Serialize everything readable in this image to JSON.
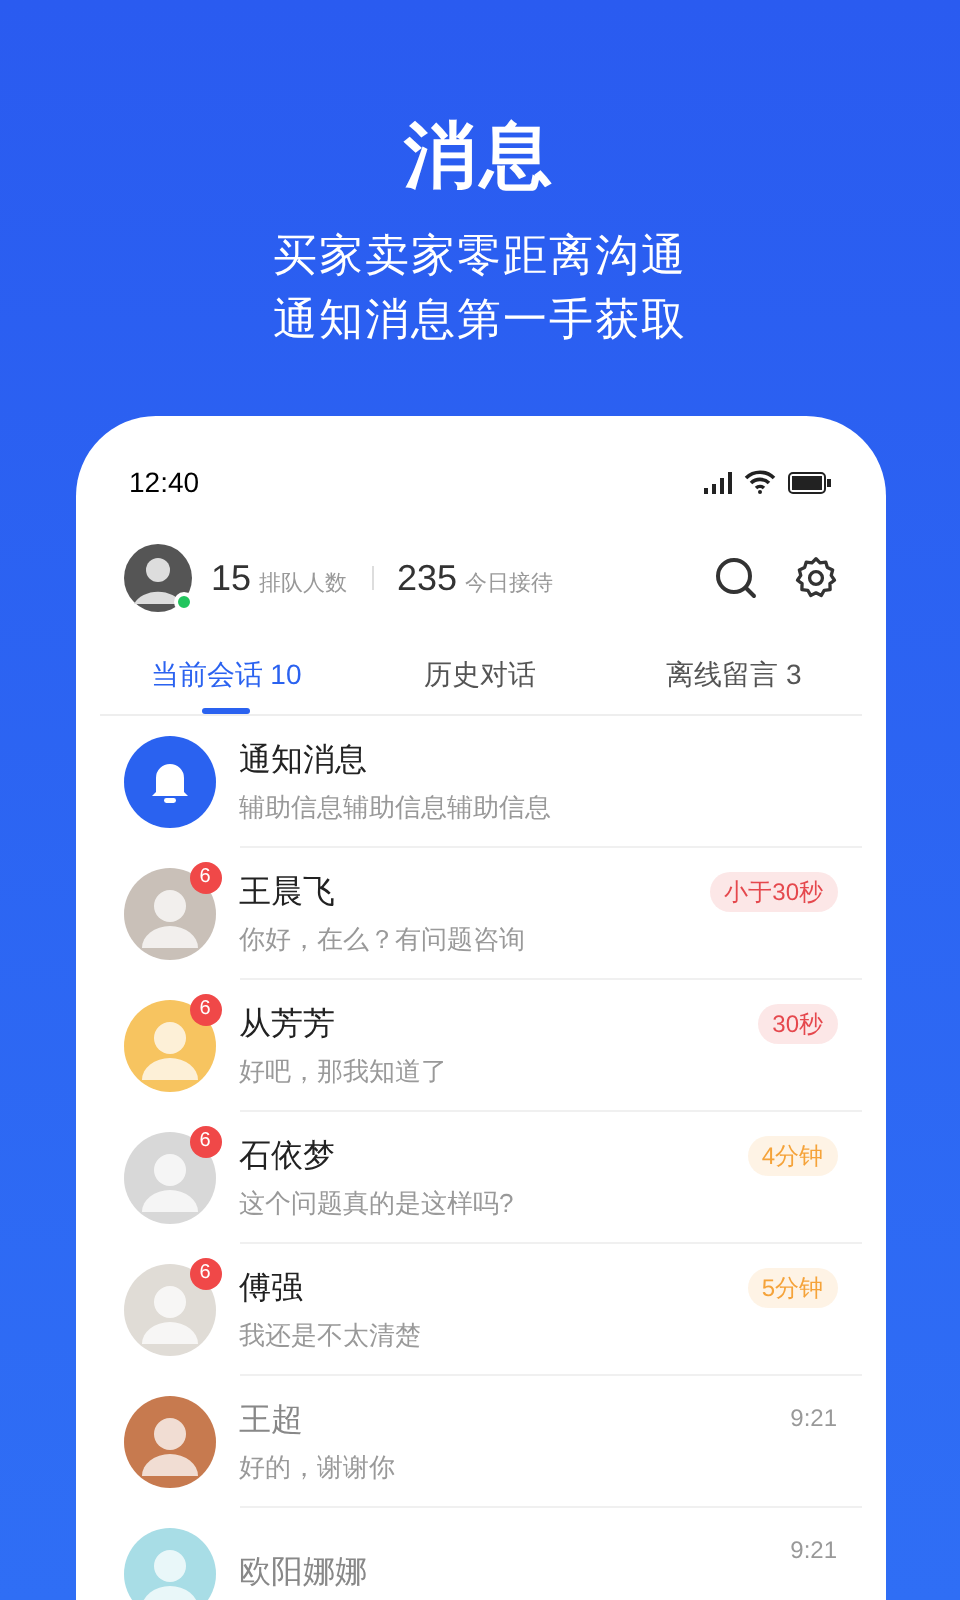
{
  "hero": {
    "title": "消息",
    "subtitle_lines": [
      "买家卖家零距离沟通",
      "通知消息第一手获取"
    ]
  },
  "status_bar": {
    "time": "12:40"
  },
  "header": {
    "stats": [
      {
        "value": "15",
        "label": "排队人数"
      },
      {
        "value": "235",
        "label": "今日接待"
      }
    ],
    "online": true
  },
  "tabs": [
    {
      "label": "当前会话 10",
      "selected": true
    },
    {
      "label": "历史对话",
      "selected": false
    },
    {
      "label": "离线留言 3",
      "selected": false
    }
  ],
  "conversations": [
    {
      "kind": "notice",
      "name": "通知消息",
      "preview": "辅助信息辅助信息辅助信息"
    },
    {
      "kind": "contact",
      "name": "王晨飞",
      "preview": "你好，在么？有问题咨询",
      "badge": "6",
      "read": false,
      "time": "小于30秒",
      "color": "#e5484d"
    },
    {
      "kind": "contact",
      "name": "从芳芳",
      "preview": "好吧，那我知道了",
      "badge": "6",
      "read": false,
      "time": "30秒",
      "color": "#e5484d"
    },
    {
      "kind": "contact",
      "name": "石依梦",
      "preview": "这个问题真的是这样吗?",
      "badge": "6",
      "read": false,
      "time": "4分钟",
      "color": "#f5a33a"
    },
    {
      "kind": "contact",
      "name": "傅强",
      "preview": "我还是不太清楚",
      "badge": "6",
      "read": false,
      "time": "5分钟",
      "color": "#f5a33a"
    },
    {
      "kind": "contact",
      "name": "王超",
      "preview": "好的，谢谢你",
      "read": true,
      "time": "9:21"
    },
    {
      "kind": "contact",
      "name": "欧阳娜娜",
      "read": true,
      "time": "9:21"
    }
  ]
}
